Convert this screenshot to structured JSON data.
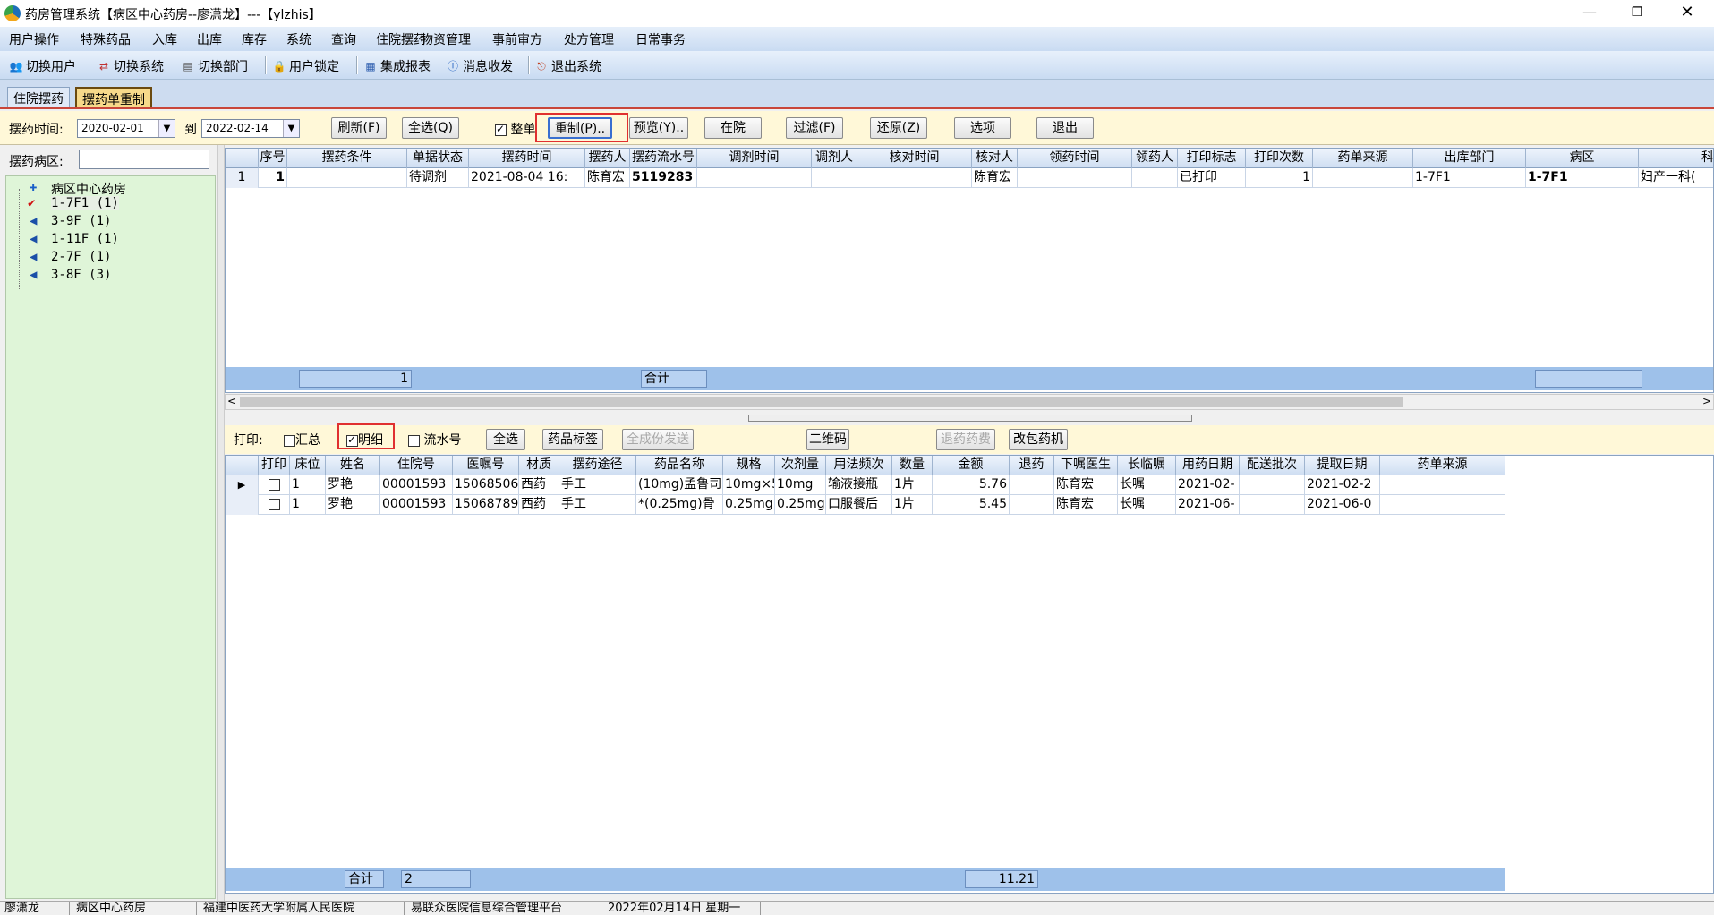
{
  "window": {
    "title": "药房管理系统【病区中心药房--廖潇龙】---【ylzhis】"
  },
  "menu": [
    "用户操作",
    "特殊药品",
    "入库",
    "出库",
    "库存",
    "系统",
    "查询",
    "住院摆药",
    "物资管理",
    "事前审方",
    "处方管理",
    "日常事务"
  ],
  "toolbar": [
    "切换用户",
    "切换系统",
    "切换部门",
    "用户锁定",
    "集成报表",
    "消息收发",
    "退出系统"
  ],
  "tabs": [
    "住院摆药",
    "摆药单重制"
  ],
  "filter": {
    "time_label": "摆药时间:",
    "date_from": "2020-02-01",
    "to_label": "到",
    "date_to": "2022-02-14",
    "buttons": {
      "refresh": "刷新(F)",
      "select_all": "全选(Q)",
      "remake": "重制(P)..",
      "preview": "预览(Y)..",
      "in_hospital": "在院",
      "filter": "过滤(F)",
      "restore": "还原(Z)",
      "options": "选项",
      "exit": "退出"
    },
    "whole_label": "整单",
    "whole_checked": true
  },
  "ward": {
    "label": "摆药病区:",
    "search_value": ""
  },
  "tree": {
    "root": "病区中心药房",
    "items": [
      "1-7F1 (1)",
      "3-9F (1)",
      "1-11F (1)",
      "2-7F (1)",
      "3-8F (3)"
    ]
  },
  "top_grid": {
    "headers": [
      "序号",
      "摆药条件",
      "单据状态",
      "摆药时间",
      "摆药人",
      "摆药流水号",
      "调剂时间",
      "调剂人",
      "核对时间",
      "核对人",
      "领药时间",
      "领药人",
      "打印标志",
      "打印次数",
      "药单来源",
      "出库部门",
      "病区",
      "科"
    ],
    "rows": [
      {
        "rownum": "1",
        "cells": [
          "1",
          "",
          "待调剂",
          "2021-08-04 16:",
          "陈育宏",
          "5119283",
          "",
          "",
          "",
          "陈育宏",
          "",
          "",
          "已打印",
          "1",
          "",
          "1-7F1",
          "1-7F1",
          "妇产一科("
        ]
      }
    ],
    "footer": {
      "count": "1",
      "sum_label": "合计"
    }
  },
  "print_bar": {
    "label": "打印:",
    "summary": "汇总",
    "summary_checked": false,
    "detail": "明细",
    "detail_checked": true,
    "serial": "流水号",
    "serial_checked": false,
    "buttons": {
      "select_all": "全选",
      "drug_label": "药品标签",
      "full_send": "全成份发送",
      "qr": "二维码",
      "return_drug": "退药药费",
      "change_pack": "改包药机"
    }
  },
  "bottom_grid": {
    "headers": [
      "打印",
      "床位",
      "姓名",
      "住院号",
      "医嘱号",
      "材质",
      "摆药途径",
      "药品名称",
      "规格",
      "次剂量",
      "用法频次",
      "数量",
      "金额",
      "退药",
      "下嘱医生",
      "长临嘱",
      "用药日期",
      "配送批次",
      "提取日期",
      "药单来源"
    ],
    "rows": [
      {
        "marker": "▶",
        "cells": [
          "",
          "1",
          "罗艳",
          "00001593",
          "15068506",
          "西药",
          "手工",
          "(10mg)孟鲁司",
          "10mg×5",
          "10mg",
          "输液接瓶",
          "1片",
          "5.76",
          "",
          "陈育宏",
          "长嘱",
          "2021-02-",
          "",
          "2021-02-2",
          ""
        ]
      },
      {
        "marker": "",
        "cells": [
          "",
          "1",
          "罗艳",
          "00001593",
          "15068789",
          "西药",
          "手工",
          "*(0.25mg)骨",
          "0.25mg",
          "0.25mg",
          "口服餐后",
          "1片",
          "5.45",
          "",
          "陈育宏",
          "长嘱",
          "2021-06-",
          "",
          "2021-06-0",
          ""
        ]
      }
    ],
    "footer": {
      "sum_label": "合计",
      "count": "2",
      "amount": "11.21"
    }
  },
  "status": [
    "廖潇龙",
    "病区中心药房",
    "福建中医药大学附属人民医院",
    "易联众医院信息综合管理平台",
    "2022年02月14日 星期一"
  ]
}
